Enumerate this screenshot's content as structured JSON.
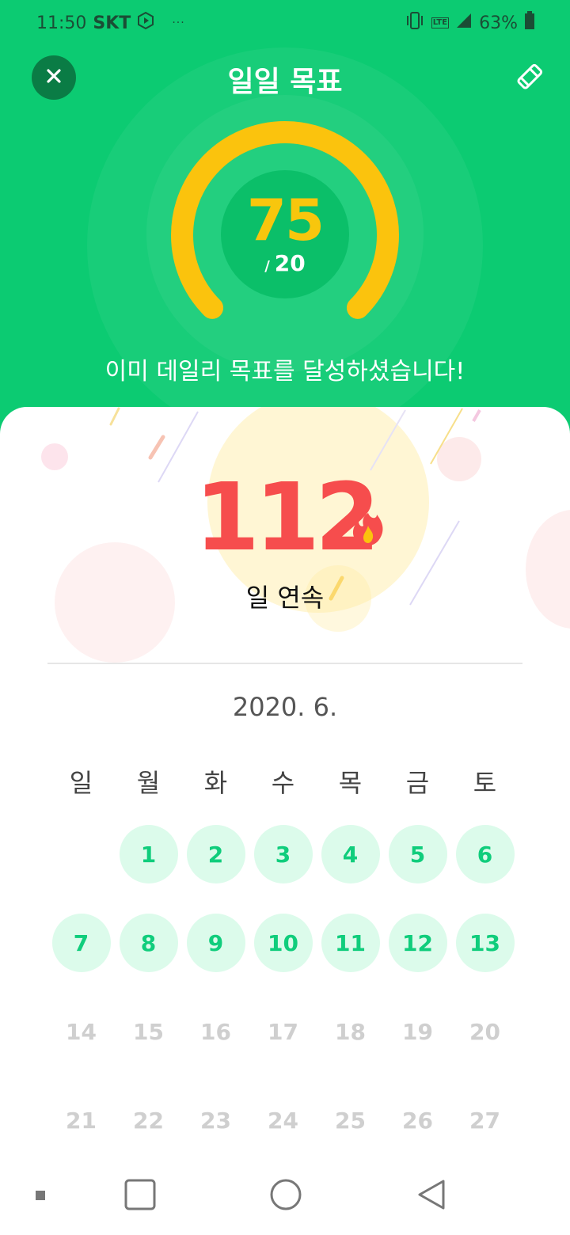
{
  "status_bar": {
    "time": "11:50",
    "carrier": "SKT",
    "overflow_dots": "···",
    "battery_percent": "63%",
    "network_label": "LTE"
  },
  "header": {
    "title": "일일 목표",
    "close_icon": "close-icon",
    "edit_icon": "pencil-icon"
  },
  "goal": {
    "current": "75",
    "slash": "/",
    "target": "20",
    "message": "이미 데일리 목표를 달성하셨습니다!",
    "progress_fraction": 1.0
  },
  "streak": {
    "count": "112",
    "label": "일 연속",
    "icon": "flame-icon"
  },
  "calendar": {
    "month_label": "2020. 6.",
    "weekdays": [
      "일",
      "월",
      "화",
      "수",
      "목",
      "금",
      "토"
    ],
    "start_offset": 1,
    "days": [
      {
        "label": "1",
        "state": "active"
      },
      {
        "label": "2",
        "state": "active"
      },
      {
        "label": "3",
        "state": "active"
      },
      {
        "label": "4",
        "state": "active"
      },
      {
        "label": "5",
        "state": "active"
      },
      {
        "label": "6",
        "state": "active"
      },
      {
        "label": "7",
        "state": "active"
      },
      {
        "label": "8",
        "state": "active"
      },
      {
        "label": "9",
        "state": "active"
      },
      {
        "label": "10",
        "state": "active"
      },
      {
        "label": "11",
        "state": "active"
      },
      {
        "label": "12",
        "state": "active"
      },
      {
        "label": "13",
        "state": "active"
      },
      {
        "label": "14",
        "state": "future"
      },
      {
        "label": "15",
        "state": "future"
      },
      {
        "label": "16",
        "state": "future"
      },
      {
        "label": "17",
        "state": "future"
      },
      {
        "label": "18",
        "state": "future"
      },
      {
        "label": "19",
        "state": "future"
      },
      {
        "label": "20",
        "state": "future"
      },
      {
        "label": "21",
        "state": "future"
      },
      {
        "label": "22",
        "state": "future"
      },
      {
        "label": "23",
        "state": "future"
      },
      {
        "label": "24",
        "state": "future"
      },
      {
        "label": "25",
        "state": "future"
      },
      {
        "label": "26",
        "state": "future"
      },
      {
        "label": "27",
        "state": "future"
      }
    ]
  },
  "nav_bar": {
    "items": [
      "recents-dot-icon",
      "overview-square-icon",
      "home-circle-icon",
      "back-triangle-icon"
    ]
  },
  "colors": {
    "header_green": "#0ccb72",
    "gauge_yellow": "#fbc30d",
    "streak_red": "#f64d4d",
    "day_active_bg": "#dcfbeb",
    "day_active_text": "#10cd7c",
    "day_future_text": "#cfcfcf"
  }
}
